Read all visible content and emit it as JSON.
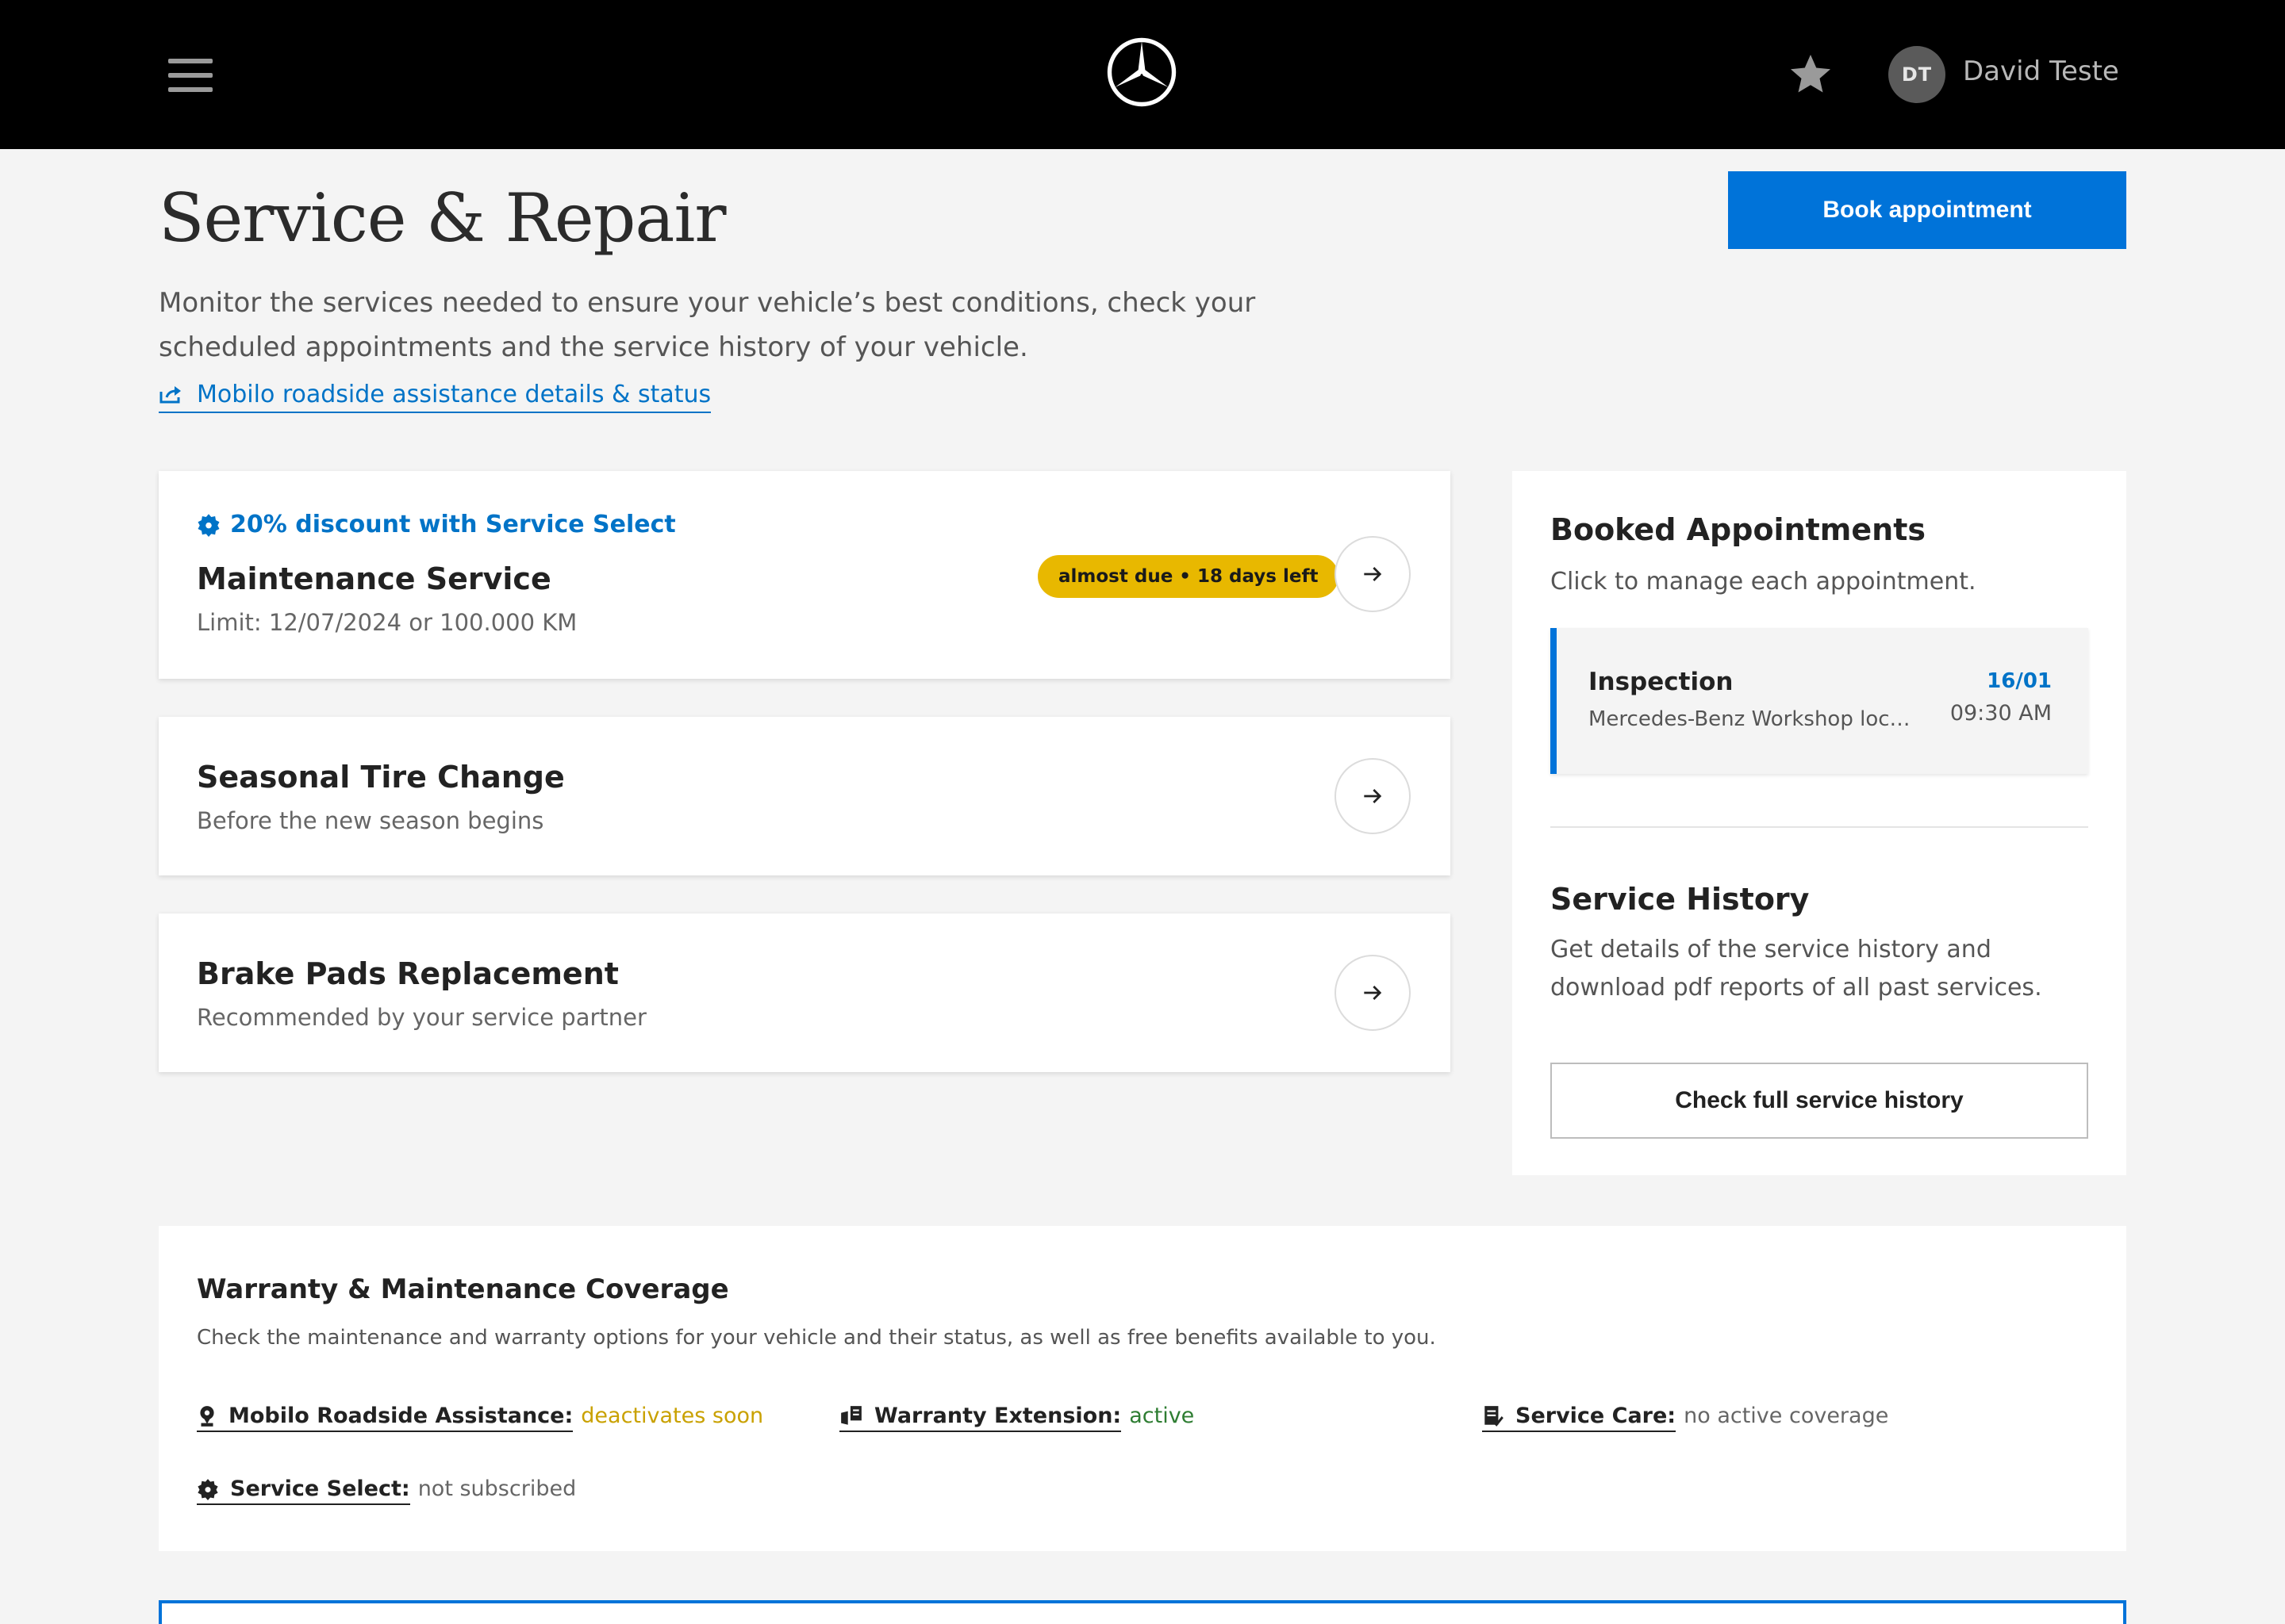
{
  "header": {
    "menu_icon": "hamburger-menu-icon",
    "logo_icon": "three-pointed-star-logo",
    "favorite_icon": "star-icon",
    "user_initials": "DT",
    "user_name": "David Teste"
  },
  "page": {
    "title": "Service & Repair",
    "description": "Monitor the services needed to ensure your vehicle’s best conditions, check your scheduled appointments and the service history of your vehicle.",
    "mobilo_link": "Mobilo roadside assistance details & status",
    "book_button": "Book appointment"
  },
  "services": [
    {
      "discount": "20% discount with Service Select",
      "title": "Maintenance Service",
      "subtitle": "Limit: 12/07/2024 or 100.000 KM",
      "badge": "almost due • 18 days left"
    },
    {
      "title": "Seasonal Tire Change",
      "subtitle": "Before the new season begins"
    },
    {
      "title": "Brake Pads Replacement",
      "subtitle": "Recommended by your service partner"
    }
  ],
  "booked": {
    "title": "Booked Appointments",
    "description": "Click to manage each appointment.",
    "appointment": {
      "title": "Inspection",
      "location": "Mercedes-Benz Workshop location",
      "date": "16/01",
      "time": "09:30 AM"
    }
  },
  "history": {
    "title": "Service History",
    "description": "Get details of the service history and download pdf reports of all past services.",
    "button": "Check full service history"
  },
  "coverage": {
    "title": "Warranty & Maintenance Coverage",
    "description": "Check the maintenance and warranty options for your vehicle and their status, as well as free benefits available to you.",
    "items": [
      {
        "label": "Mobilo Roadside Assistance:",
        "status": "deactivates soon",
        "status_color": "#c9a100",
        "icon": "roadside-pin-icon"
      },
      {
        "label": "Warranty Extension:",
        "status": "active",
        "status_color": "#2e7d32",
        "icon": "warranty-shield-icon"
      },
      {
        "label": "Service Care:",
        "status": "no active coverage",
        "status_color": "#666666",
        "icon": "service-document-icon"
      },
      {
        "label": "Service Select:",
        "status": "not subscribed",
        "status_color": "#666666",
        "icon": "service-badge-icon"
      }
    ]
  },
  "colors": {
    "accent": "#0073d9",
    "link": "#0073c7",
    "badge": "#e8b800",
    "header_bg": "#000000",
    "page_bg": "#f4f4f4"
  }
}
